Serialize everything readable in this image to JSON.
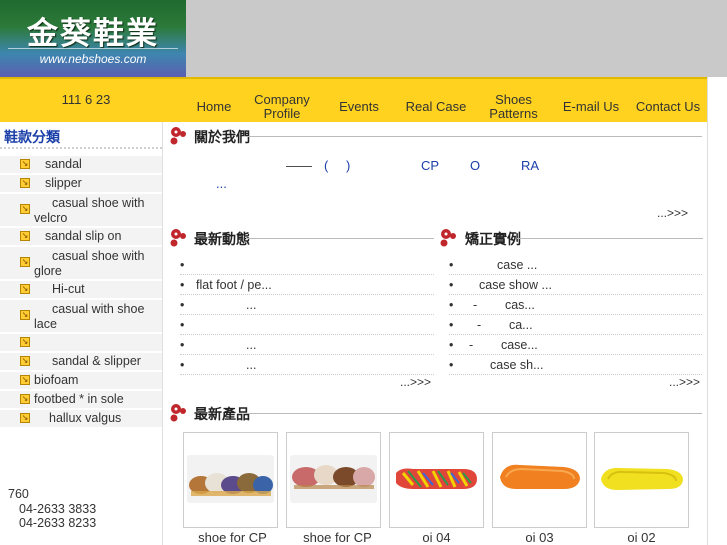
{
  "logo": {
    "title": "金葵鞋業",
    "url": "www.nebshoes.com"
  },
  "header": {
    "phone": "111 6 23"
  },
  "nav": [
    {
      "label": "Home"
    },
    {
      "label": "Company Profile"
    },
    {
      "label": "Events"
    },
    {
      "label": "Real Case"
    },
    {
      "label": "Shoes Patterns"
    },
    {
      "label": "E-mail Us"
    },
    {
      "label": "Contact Us"
    }
  ],
  "sidebar": {
    "title": "鞋款分類",
    "items": [
      {
        "label": "sandal"
      },
      {
        "label": "slipper"
      },
      {
        "label": "casual shoe with velcro"
      },
      {
        "label": "sandal slip on"
      },
      {
        "label": "casual shoe with glore"
      },
      {
        "label": "Hi-cut"
      },
      {
        "label": "casual with shoe lace"
      },
      {
        "label": ""
      },
      {
        "label": "sandal & slipper"
      },
      {
        "label": "biofoam"
      },
      {
        "label": "footbed * in sole"
      },
      {
        "label": "hallux valgus"
      }
    ],
    "address": [
      "760",
      "04-2633 3833",
      "04-2633 8233"
    ]
  },
  "about": {
    "title": "關於我們",
    "line1": [
      "——",
      "(",
      ")",
      "CP",
      "O",
      "RA"
    ],
    "line2": "...",
    "more": "...>>>"
  },
  "news": {
    "title": "最新動態",
    "items": [
      "",
      "flat foot / pe...",
      "...",
      "",
      "...",
      "..."
    ],
    "more": "...>>>"
  },
  "cases": {
    "title": "矯正實例",
    "items": [
      "case ...",
      "case show ...",
      "-        cas...",
      "-        ca...",
      "-        case...",
      "case sh..."
    ],
    "more": "...>>>"
  },
  "products": {
    "title": "最新產品",
    "items": [
      {
        "label": "shoe for CP"
      },
      {
        "label": "shoe for CP"
      },
      {
        "label": "oi 04"
      },
      {
        "label": "oi 03"
      },
      {
        "label": "oi 02"
      }
    ]
  },
  "colors": {
    "nav_bar": "#ffd21f",
    "accent": "#c0272d",
    "link": "#1b3fa8"
  }
}
